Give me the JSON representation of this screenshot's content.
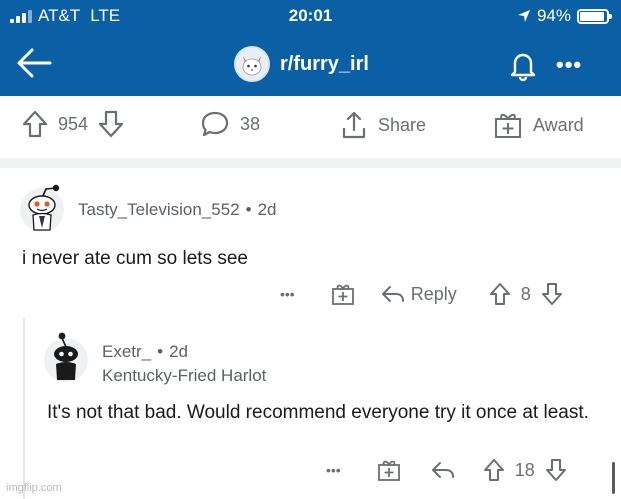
{
  "status_bar": {
    "carrier": "AT&T",
    "network": "LTE",
    "time": "20:01",
    "battery": "94%",
    "battery_level": 0.94
  },
  "nav": {
    "subreddit": "r/furry_irl",
    "back_icon": "arrow-left-icon",
    "bell_icon": "bell-icon",
    "more_icon": "more-horizontal-icon"
  },
  "post_actions": {
    "upvotes": "954",
    "comments": "38",
    "share_label": "Share",
    "award_label": "Award"
  },
  "comments": [
    {
      "username": "Tasty_Television_552",
      "separator": "•",
      "age": "2d",
      "body": "i never ate cum so lets see",
      "actions": {
        "more": "•••",
        "reply_label": "Reply",
        "votes": "8"
      }
    },
    {
      "username": "Exetr_",
      "separator": "•",
      "age": "2d",
      "flair": "Kentucky-Fried Harlot",
      "body": "It's not that bad.  Would recommend everyone try it once at least.",
      "actions": {
        "more": "•••",
        "votes": "18"
      }
    }
  ],
  "watermark": "imgflip.com",
  "colors": {
    "header_bg": "#0b5fa5",
    "text_primary": "#1a1a1b",
    "text_secondary": "#6b6f72",
    "divider": "#f1f2f4"
  }
}
